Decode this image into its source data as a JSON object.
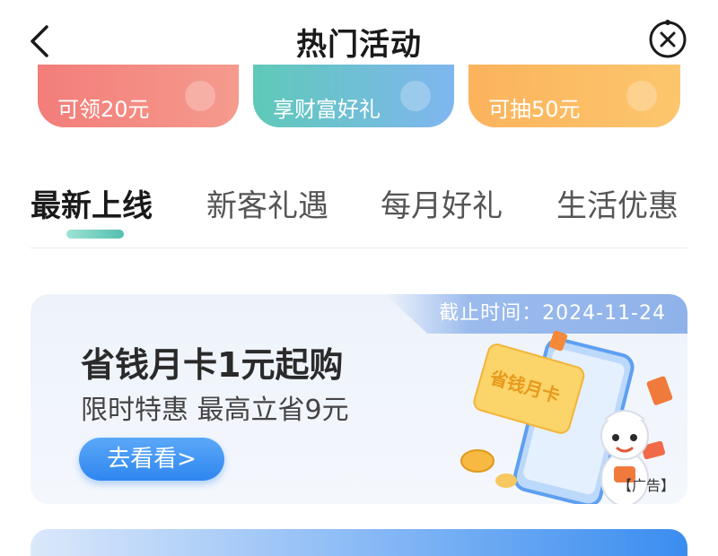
{
  "header": {
    "title": "热门活动",
    "back_icon": "chevron-left-icon",
    "close_icon": "close-circle-icon"
  },
  "promos": [
    {
      "subtitle": "可领20元",
      "color": "#f37d7a"
    },
    {
      "subtitle": "享财富好礼",
      "color": "#5fc9b8"
    },
    {
      "subtitle": "可抽50元",
      "color": "#fbb35c"
    }
  ],
  "tabs": [
    {
      "label": "最新上线",
      "active": true
    },
    {
      "label": "新客礼遇",
      "active": false
    },
    {
      "label": "每月好礼",
      "active": false
    },
    {
      "label": "生活优惠",
      "active": false
    }
  ],
  "card": {
    "deadline": "截止时间：2024-11-24",
    "title": "省钱月卡1元起购",
    "subtitle": "限时特惠 最高立省9元",
    "cta": "去看看>",
    "ad_label": "【广告】",
    "illustration_text": "省钱月卡"
  },
  "colors": {
    "accent": "#54bfae",
    "cta_blue": "#2f86ef",
    "card_bg": "#eef3fb"
  }
}
